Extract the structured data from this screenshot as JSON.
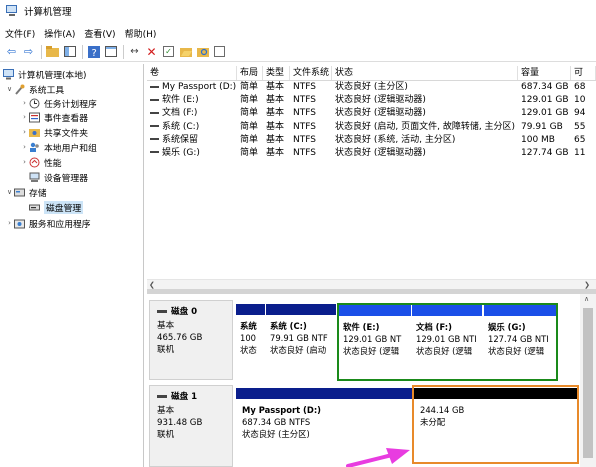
{
  "window": {
    "title": "计算机管理"
  },
  "menu": [
    "文件(F)",
    "操作(A)",
    "查看(V)",
    "帮助(H)"
  ],
  "tree": {
    "root": "计算机管理(本地)",
    "system_tools": "系统工具",
    "task_scheduler": "任务计划程序",
    "event_viewer": "事件查看器",
    "shared_folders": "共享文件夹",
    "local_users": "本地用户和组",
    "performance": "性能",
    "device_manager": "设备管理器",
    "storage": "存储",
    "disk_management": "磁盘管理",
    "services": "服务和应用程序"
  },
  "volume_table": {
    "headers": [
      "卷",
      "布局",
      "类型",
      "文件系统",
      "状态",
      "容量",
      "可"
    ],
    "rows": [
      {
        "volume": "My Passport (D:)",
        "layout": "简单",
        "type": "基本",
        "fs": "NTFS",
        "status": "状态良好 (主分区)",
        "capacity": "687.34 GB",
        "free": "68"
      },
      {
        "volume": "软件 (E:)",
        "layout": "简单",
        "type": "基本",
        "fs": "NTFS",
        "status": "状态良好 (逻辑驱动器)",
        "capacity": "129.01 GB",
        "free": "10"
      },
      {
        "volume": "文档 (F:)",
        "layout": "简单",
        "type": "基本",
        "fs": "NTFS",
        "status": "状态良好 (逻辑驱动器)",
        "capacity": "129.01 GB",
        "free": "94"
      },
      {
        "volume": "系统 (C:)",
        "layout": "简单",
        "type": "基本",
        "fs": "NTFS",
        "status": "状态良好 (启动, 页面文件, 故障转储, 主分区)",
        "capacity": "79.91 GB",
        "free": "55"
      },
      {
        "volume": "系统保留",
        "layout": "简单",
        "type": "基本",
        "fs": "NTFS",
        "status": "状态良好 (系统, 活动, 主分区)",
        "capacity": "100 MB",
        "free": "65"
      },
      {
        "volume": "娱乐 (G:)",
        "layout": "简单",
        "type": "基本",
        "fs": "NTFS",
        "status": "状态良好 (逻辑驱动器)",
        "capacity": "127.74 GB",
        "free": "11"
      }
    ]
  },
  "disk0": {
    "name": "磁盘 0",
    "type": "基本",
    "size": "465.76 GB",
    "state": "联机",
    "partitions": [
      {
        "name": "系统",
        "line2": "100",
        "line3": "状态"
      },
      {
        "name": "系统 (C:)",
        "line2": "79.91 GB NTF",
        "line3": "状态良好 (启动"
      },
      {
        "name": "软件 (E:)",
        "line2": "129.01 GB NT",
        "line3": "状态良好 (逻辑"
      },
      {
        "name": "文档 (F:)",
        "line2": "129.01 GB NTI",
        "line3": "状态良好 (逻辑"
      },
      {
        "name": "娱乐 (G:)",
        "line2": "127.74 GB NTI",
        "line3": "状态良好 (逻辑"
      }
    ]
  },
  "disk1": {
    "name": "磁盘 1",
    "type": "基本",
    "size": "931.48 GB",
    "state": "联机",
    "partitions": [
      {
        "name": "My Passport (D:)",
        "line2": "687.34 GB NTFS",
        "line3": "状态良好 (主分区)"
      },
      {
        "name": "",
        "line2": "244.14 GB",
        "line3": "未分配"
      }
    ]
  },
  "colors": {
    "partition_bar": "#0a1e8c",
    "extended_bar": "#1a4fe8",
    "unallocated_bar": "#000000",
    "extended_border": "#1a8a1a",
    "highlight_border": "#e88a2a",
    "arrow": "#e83ce0"
  }
}
